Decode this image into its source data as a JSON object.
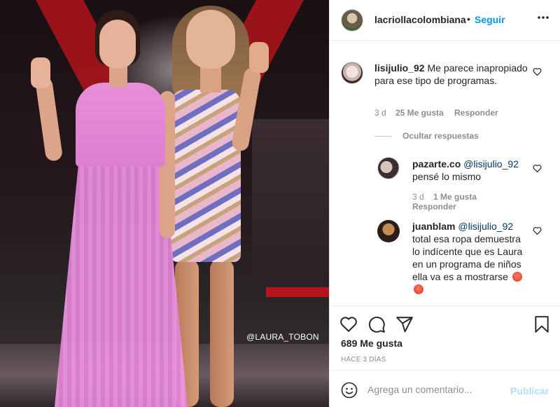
{
  "photo": {
    "watermark": "@LAURA_TOBON"
  },
  "header": {
    "username": "lacriollacolombiana",
    "separator": "•",
    "follow_label": "Seguir",
    "more_icon": "ellipsis-icon"
  },
  "comments": {
    "main": {
      "username": "lisijulio_92",
      "text": "Me parece inapropiado para ese tipo de programas.",
      "time": "3 d",
      "likes": "25 Me gusta",
      "reply_label": "Responder"
    },
    "hide_replies_label": "Ocultar respuestas",
    "replies": [
      {
        "username": "pazarte.co",
        "mention": "@lisijulio_92",
        "text": "pensé lo mismo",
        "time": "3 d",
        "likes": "1 Me gusta",
        "reply_label": "Responder"
      },
      {
        "username": "juanblam",
        "mention": "@lisijulio_92",
        "text": "total esa ropa demuestra lo indícente que es Laura en un programa de niños ella va es a mostrarse"
      }
    ]
  },
  "actions": {
    "likes": "689 Me gusta",
    "time": "HACE 3 DÍAS"
  },
  "add_comment": {
    "placeholder": "Agrega un comentario...",
    "publish_label": "Publicar"
  },
  "colors": {
    "link": "#0095f6",
    "publish_disabled": "#b2dffc",
    "muted": "#8e8e8e",
    "text": "#262626"
  }
}
